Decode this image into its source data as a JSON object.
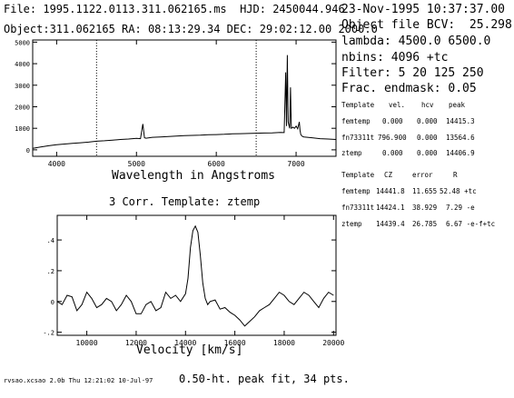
{
  "header": {
    "file_line": "File: 1995.1122.0113.311.062165.ms  HJD: 2450044.946",
    "object_line": "Object:311.062165 RA: 08:13:29.34 DEC: 29:02:12.00 2000.0"
  },
  "right_panel": {
    "date": "23-Nov-1995 10:37:37.00",
    "bcv": "Object file BCV:  25.298",
    "lambda": "lambda: 4500.0 6500.0",
    "nbins": "nbins: 4096 +tc",
    "filter": "Filter: 5 20 125 250",
    "endmask": "Frac. endmask: 0.05",
    "table1": {
      "headers": [
        "Template",
        "vel.",
        "hcv",
        "peak"
      ],
      "rows": [
        [
          "femtemp",
          "0.000",
          "0.000",
          "14415.3"
        ],
        [
          "fn73311t",
          "796.900",
          "0.000",
          "13564.6"
        ],
        [
          "ztemp",
          "0.000",
          "0.000",
          "14406.9"
        ]
      ]
    },
    "table2": {
      "headers": [
        "Template",
        "CZ",
        "error",
        "R"
      ],
      "rows": [
        [
          "femtemp",
          "14441.8",
          "11.655",
          "52.48 +tc"
        ],
        [
          "fn73311t",
          "14424.1",
          "38.929",
          "7.29 -e"
        ],
        [
          "ztemp",
          "14439.4",
          "26.785",
          "6.67 -e-f+tc"
        ]
      ]
    }
  },
  "footer": {
    "version": "rvsao.xcsao 2.0b Thu 12:21:02 10-Jul-97",
    "fit": "0.50-ht. peak fit, 34 pts."
  },
  "chart_data": [
    {
      "type": "line",
      "title": "",
      "xlabel": "Wavelength in Angstroms",
      "ylabel": "",
      "xlim": [
        3700,
        7500
      ],
      "ylim": [
        -300,
        5100
      ],
      "xticks": [
        "4000",
        "5000",
        "6000",
        "7000"
      ],
      "xtick_values": [
        4000,
        5000,
        6000,
        7000
      ],
      "yticks": [
        "0",
        "1000",
        "2000",
        "3000",
        "4000",
        "5000"
      ],
      "ytick_values": [
        0,
        1000,
        2000,
        3000,
        4000,
        5000
      ],
      "markers": [
        4500,
        6500
      ],
      "series": [
        {
          "x": [
            3700,
            3800,
            3900,
            4000,
            4100,
            4200,
            4300,
            4400,
            4500,
            4600,
            4700,
            4800,
            4900,
            5000,
            5050,
            5080,
            5100,
            5120,
            5200,
            5300,
            5400,
            5500,
            5600,
            5700,
            5800,
            5900,
            6000,
            6100,
            6200,
            6300,
            6400,
            6500,
            6600,
            6700,
            6800,
            6850,
            6870,
            6880,
            6890,
            6900,
            6920,
            6930,
            6940,
            6960,
            6980,
            7000,
            7020,
            7040,
            7050,
            7060,
            7080,
            7100,
            7200,
            7300,
            7400,
            7500
          ],
          "y": [
            70,
            130,
            190,
            240,
            270,
            300,
            330,
            360,
            400,
            420,
            450,
            480,
            500,
            530,
            520,
            1200,
            560,
            540,
            580,
            600,
            620,
            640,
            660,
            670,
            680,
            700,
            710,
            720,
            740,
            750,
            760,
            770,
            780,
            790,
            810,
            800,
            3600,
            1100,
            4400,
            1300,
            1000,
            2900,
            1000,
            1050,
            1000,
            1100,
            980,
            1300,
            900,
            700,
            620,
            600,
            560,
            520,
            500,
            480
          ]
        }
      ]
    },
    {
      "type": "line",
      "title": "3 Corr. Template: ztemp",
      "xlabel": "Velocity [km/s]",
      "ylabel": "",
      "xlim": [
        8800,
        20100
      ],
      "ylim": [
        -0.22,
        0.56
      ],
      "xticks": [
        "10000",
        "12000",
        "14000",
        "16000",
        "18000",
        "20000"
      ],
      "xtick_values": [
        10000,
        12000,
        14000,
        16000,
        18000,
        20000
      ],
      "yticks": [
        "-.2",
        "0",
        ".2",
        ".4"
      ],
      "ytick_values": [
        -0.2,
        0,
        0.2,
        0.4
      ],
      "series": [
        {
          "x": [
            8800,
            9000,
            9200,
            9400,
            9600,
            9800,
            10000,
            10200,
            10400,
            10600,
            10800,
            11000,
            11200,
            11400,
            11600,
            11800,
            12000,
            12200,
            12400,
            12600,
            12800,
            13000,
            13200,
            13400,
            13600,
            13800,
            14000,
            14100,
            14200,
            14300,
            14400,
            14500,
            14600,
            14700,
            14800,
            14900,
            15000,
            15200,
            15400,
            15600,
            15800,
            16000,
            16200,
            16400,
            16600,
            16800,
            17000,
            17200,
            17400,
            17600,
            17800,
            18000,
            18200,
            18400,
            18600,
            18800,
            19000,
            19200,
            19400,
            19600,
            19800,
            20000
          ],
          "y": [
            0.0,
            -0.02,
            0.04,
            0.03,
            -0.06,
            -0.02,
            0.06,
            0.02,
            -0.04,
            -0.02,
            0.02,
            0.0,
            -0.06,
            -0.02,
            0.04,
            0.0,
            -0.08,
            -0.08,
            -0.02,
            0.0,
            -0.06,
            -0.04,
            0.06,
            0.02,
            0.04,
            0.0,
            0.05,
            0.15,
            0.35,
            0.46,
            0.49,
            0.45,
            0.3,
            0.12,
            0.02,
            -0.02,
            0.0,
            0.01,
            -0.05,
            -0.04,
            -0.07,
            -0.09,
            -0.12,
            -0.16,
            -0.13,
            -0.1,
            -0.06,
            -0.04,
            -0.02,
            0.02,
            0.06,
            0.04,
            0.0,
            -0.02,
            0.02,
            0.06,
            0.04,
            0.0,
            -0.04,
            0.02,
            0.06,
            0.04
          ]
        }
      ]
    }
  ]
}
